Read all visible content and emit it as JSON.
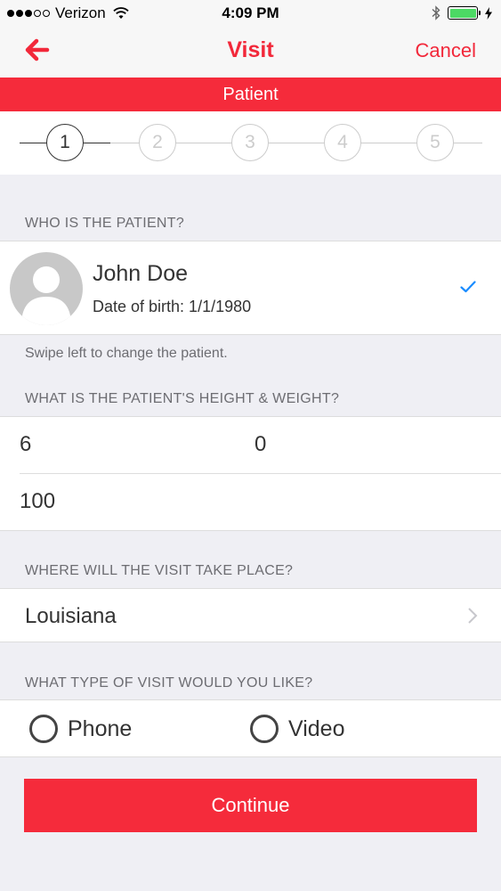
{
  "status_bar": {
    "carrier": "Verizon",
    "time": "4:09 PM",
    "signal_icon": "signal-dots-icon",
    "wifi_icon": "wifi-icon",
    "bluetooth_icon": "bluetooth-icon",
    "battery_level": 1.0,
    "battery_color": "#4cd964"
  },
  "nav": {
    "back_icon": "arrow-left-icon",
    "title": "Visit",
    "cancel_label": "Cancel"
  },
  "banner": {
    "label": "Patient"
  },
  "stepper": {
    "steps": [
      "1",
      "2",
      "3",
      "4",
      "5"
    ],
    "current_step": 1
  },
  "patient_section": {
    "header": "WHO IS THE PATIENT?",
    "name": "John Doe",
    "dob": "Date of birth: 1/1/1980",
    "avatar_icon": "person-silhouette-icon",
    "selected_icon": "checkmark-icon",
    "footnote": "Swipe left to change the patient."
  },
  "height_weight_section": {
    "header": "WHAT IS THE PATIENT'S HEIGHT & WEIGHT?",
    "height_feet": "6",
    "height_inches": "0",
    "weight": "100"
  },
  "location_section": {
    "header": "WHERE WILL THE VISIT TAKE PLACE?",
    "value": "Louisiana",
    "chevron_icon": "chevron-right-icon"
  },
  "visit_type_section": {
    "header": "WHAT TYPE OF VISIT WOULD YOU LIKE?",
    "options": [
      "Phone",
      "Video"
    ]
  },
  "continue_label": "Continue",
  "colors": {
    "accent": "#f2283a",
    "banner": "#f52b3b",
    "background": "#efeff4",
    "check": "#1a8cff"
  }
}
